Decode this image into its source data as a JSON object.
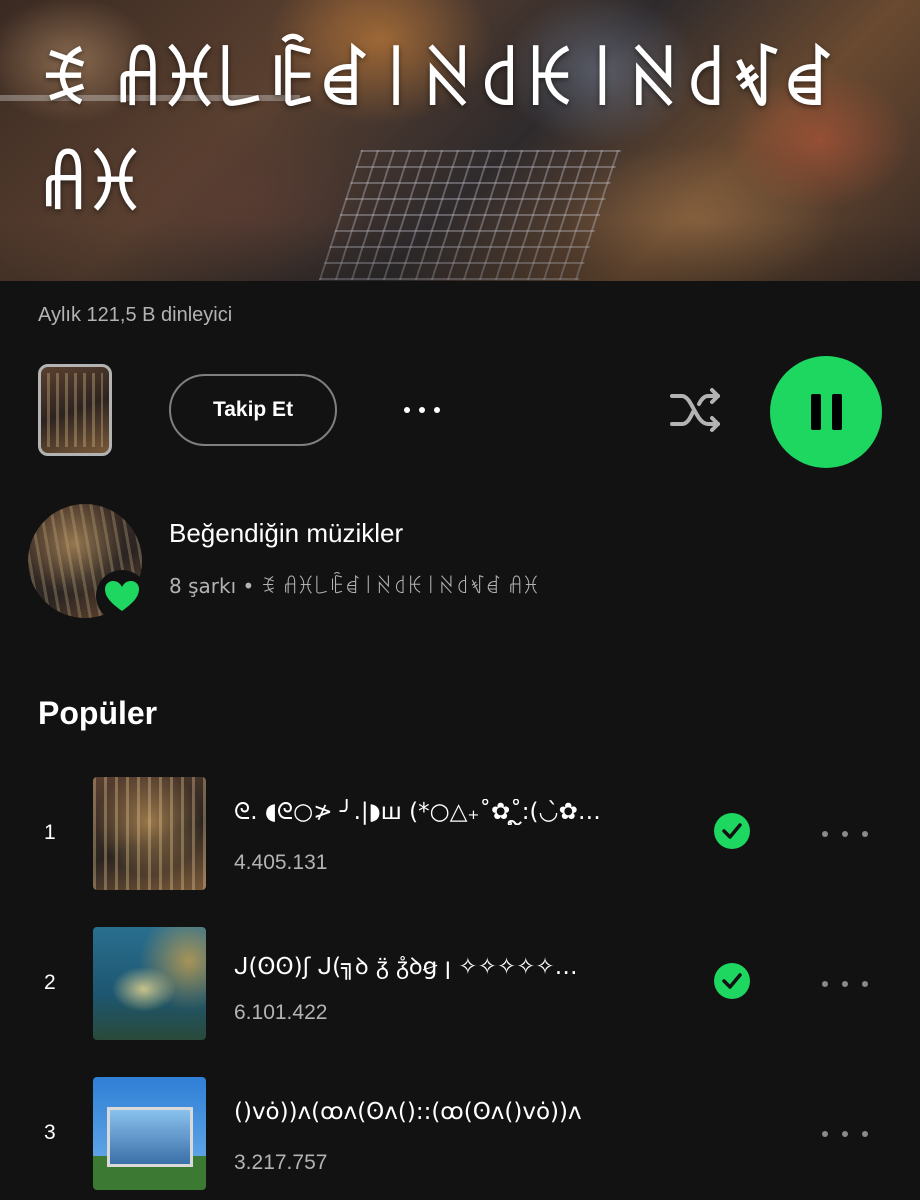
{
  "artist": {
    "name": "ꉂ ꋬꁝ꒒ꍟꀸ꒐ꋊ꒯ꀘ꒐ꋊ꒯ꃴꀸ ꋬꁝ"
  },
  "stats": {
    "monthly_listeners": "Aylık 121,5 B dinleyici"
  },
  "actions": {
    "follow_label": "Takip Et"
  },
  "liked": {
    "title": "Beğendiğin müzikler",
    "subtitle": "8 şarkı • ꉂ ꋬꁝ꒒ꍟꀸ꒐ꋊ꒯ꀘ꒐ꋊ꒯ꃴꀸ ꋬꁝ"
  },
  "popular": {
    "heading": "Popüler",
    "tracks": [
      {
        "rank": "1",
        "title": "ᘓ. ◖ᘓ○≯ ╯.|◗ш (*○△₊˚✿˚ຼ:(◡̀✿…",
        "plays": "4.405.131",
        "saved": true
      },
      {
        "rank": "2",
        "title": "ᒍ(ʘʘ)ʃ ᒍ(╗ꝺ ᵹ̈ ᵹ̊ꝺꞡ ꞁ̲ ✧✧✧✧✧…",
        "plays": "6.101.422",
        "saved": true
      },
      {
        "rank": "3",
        "title": "()vȯ))ᴧ(ꝏᴧ(ʘᴧ()::(ꝏ(ʘᴧ()vȯ))ᴧ",
        "plays": "3.217.757",
        "saved": false
      }
    ]
  },
  "colors": {
    "background": "#121212",
    "accent": "#1ed760",
    "secondary_text": "#b3b3b3"
  },
  "icons": {
    "more": "more-dots-icon",
    "shuffle": "shuffle-icon",
    "pause": "pause-icon",
    "heart": "heart-icon",
    "check": "check-icon"
  }
}
